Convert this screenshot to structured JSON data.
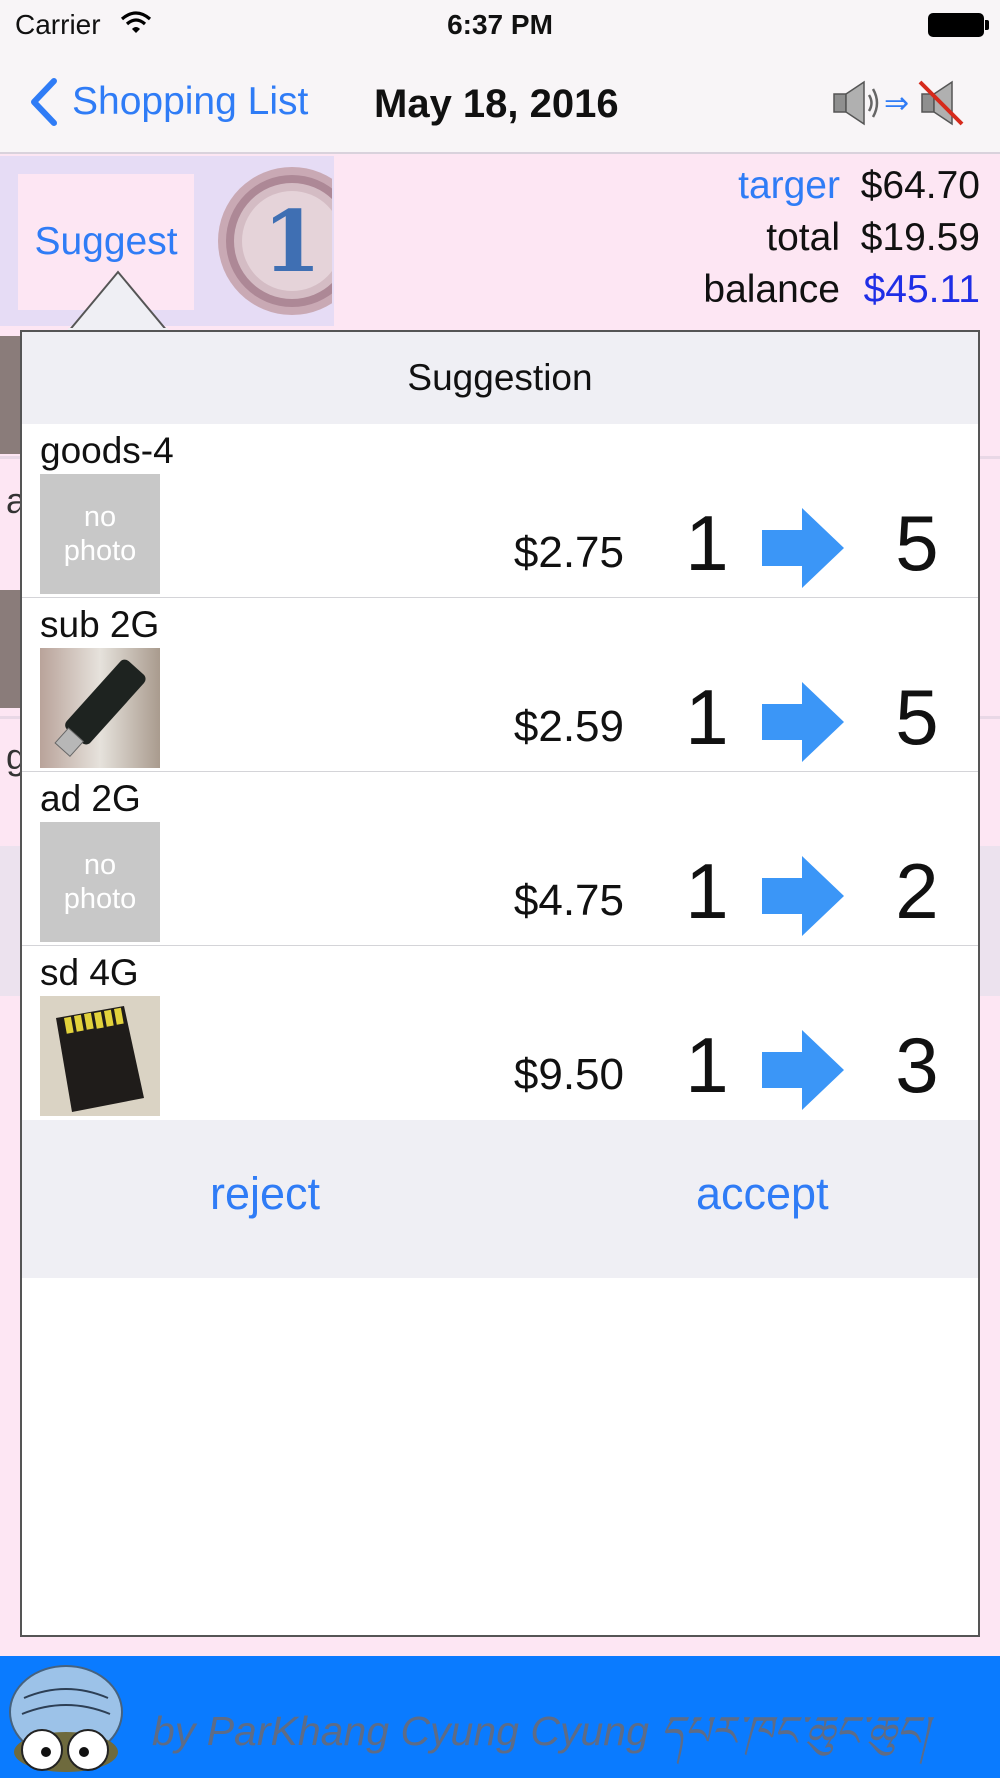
{
  "status_bar": {
    "carrier": "Carrier",
    "time": "6:37 PM"
  },
  "nav": {
    "back_label": "Shopping List",
    "title": "May 18, 2016",
    "sound_toggle_icon": "speaker-to-mute-icon"
  },
  "summary": {
    "suggest_label": "Suggest",
    "medal_number": "1",
    "rows": [
      {
        "label": "targer",
        "value": "$64.70"
      },
      {
        "label": "total",
        "value": "$19.59"
      },
      {
        "label": "balance",
        "value": "$45.11"
      }
    ]
  },
  "background_list": {
    "visible_letters": [
      "a",
      "g"
    ]
  },
  "popover": {
    "title": "Suggestion",
    "items": [
      {
        "name": "goods-4",
        "photo": "no photo",
        "price": "$2.75",
        "from_qty": "1",
        "to_qty": "5"
      },
      {
        "name": "sub 2G",
        "photo": "usb-stick",
        "price": "$2.59",
        "from_qty": "1",
        "to_qty": "5"
      },
      {
        "name": "ad 2G",
        "photo": "no photo",
        "price": "$4.75",
        "from_qty": "1",
        "to_qty": "2"
      },
      {
        "name": "sd 4G",
        "photo": "sd-card",
        "price": "$9.50",
        "from_qty": "1",
        "to_qty": "3"
      }
    ],
    "no_photo_line1": "no",
    "no_photo_line2": "photo",
    "reject_label": "reject",
    "accept_label": "accept"
  },
  "footer": {
    "credit": "by ParKhang Cyung Cyung དཔར་ཁང་ཆུང་ཆུང།",
    "logo_icon": "parkhang-mascot-logo"
  },
  "colors": {
    "accent": "#2f7cf6",
    "balance": "#1f2ee6",
    "footer_bg": "#0a7bff",
    "list_bg": "#fde6f3"
  }
}
